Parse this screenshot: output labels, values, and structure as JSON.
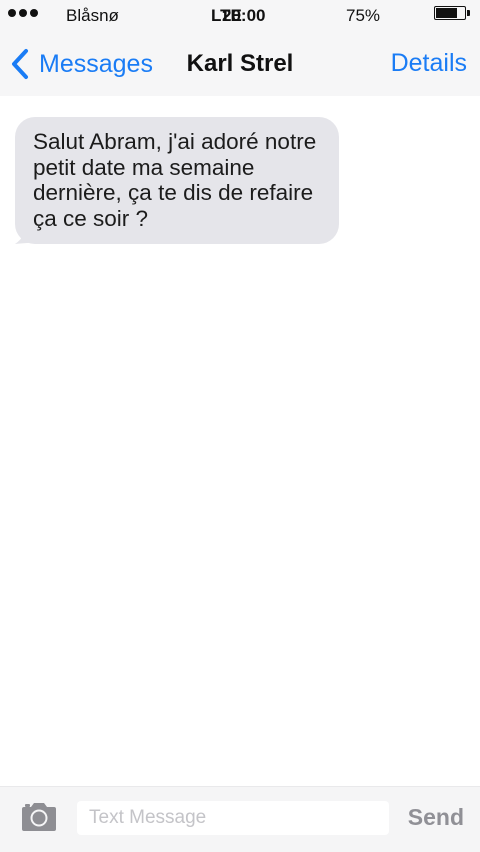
{
  "status_bar": {
    "carrier": "Blåsnø",
    "network": "LTE",
    "time": "20:00",
    "battery_percent": "75%",
    "battery_level": 0.75
  },
  "nav": {
    "back_label": "Messages",
    "title": "Karl Strel",
    "details_label": "Details",
    "accent_color": "#1a7cf5"
  },
  "messages": [
    {
      "direction": "incoming",
      "text": "Salut Abram, j'ai adoré notre petit date ma semaine dernière, ça te dis de refaire ça ce soir ?",
      "bubble_color": "#e5e5ea"
    }
  ],
  "composer": {
    "placeholder": "Text Message",
    "value": "",
    "send_label": "Send"
  },
  "icons": {
    "back": "chevron-left-icon",
    "camera": "camera-icon",
    "signal": "signal-dots-icon",
    "battery": "battery-icon"
  }
}
